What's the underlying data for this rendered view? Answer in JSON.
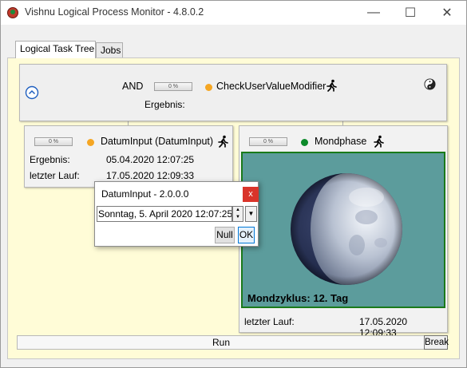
{
  "window": {
    "title": "Vishnu Logical Process Monitor - 4.8.0.2",
    "minimize_glyph": "—",
    "maximize_glyph": "☐",
    "close_glyph": "✕"
  },
  "tabs": [
    {
      "label": "Logical Task Tree",
      "active": true
    },
    {
      "label": "Jobs",
      "active": false
    }
  ],
  "root_node": {
    "operator": "AND",
    "progress": "0 %",
    "status_color": "#f5a623",
    "name": "CheckUserValueModifier",
    "result_label": "Ergebnis:",
    "result_value": "",
    "collapse_icon": "chevron-up-circle-icon",
    "run_icon": "running-man-icon",
    "yin_yang_icon": "yin-yang-icon"
  },
  "left_node": {
    "progress": "0 %",
    "status_color": "#f5a623",
    "name": "DatumInput (DatumInput)",
    "result_label": "Ergebnis:",
    "result_value": "05.04.2020 12:07:25",
    "last_run_label": "letzter Lauf:",
    "last_run_value": "17.05.2020 12:09:33",
    "run_icon": "running-man-icon"
  },
  "right_node": {
    "progress": "0 %",
    "status_color": "#0c8a2a",
    "name": "Mondphase",
    "moon_caption": "Mondzyklus: 12. Tag",
    "last_run_label": "letzter Lauf:",
    "last_run_value": "17.05.2020 12:09:33",
    "run_icon": "running-man-icon"
  },
  "statusbar": {
    "run_label": "Run",
    "break_label": "Break"
  },
  "popup": {
    "title": "DatumInput - 2.0.0.0",
    "close_glyph": "x",
    "date_value": "Sonntag, 5. April 2020 12:07:25",
    "spin_up_glyph": "▲",
    "spin_down_glyph": "▼",
    "dropdown_glyph": "▼",
    "null_label": "Null",
    "ok_label": "OK"
  }
}
